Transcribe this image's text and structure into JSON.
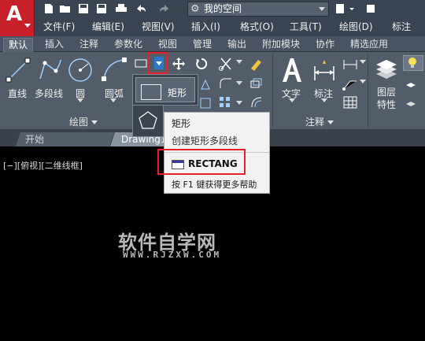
{
  "app": {
    "logo_letter": "A"
  },
  "workspace": {
    "value": "我的空间"
  },
  "menu": [
    {
      "label": "文件(F)"
    },
    {
      "label": "编辑(E)"
    },
    {
      "label": "视图(V)"
    },
    {
      "label": "插入(I)"
    },
    {
      "label": "格式(O)"
    },
    {
      "label": "工具(T)"
    },
    {
      "label": "绘图(D)"
    },
    {
      "label": "标注"
    }
  ],
  "ribbon_tabs": [
    {
      "label": "默认",
      "active": true
    },
    {
      "label": "插入"
    },
    {
      "label": "注释"
    },
    {
      "label": "参数化"
    },
    {
      "label": "视图"
    },
    {
      "label": "管理"
    },
    {
      "label": "输出"
    },
    {
      "label": "附加模块"
    },
    {
      "label": "协作"
    },
    {
      "label": "精选应用"
    }
  ],
  "draw_panel": {
    "title": "绘图",
    "tools": [
      {
        "label": "直线",
        "icon": "line-icon"
      },
      {
        "label": "多段线",
        "icon": "polyline-icon"
      },
      {
        "label": "圆",
        "icon": "circle-icon"
      },
      {
        "label": "圆弧",
        "icon": "arc-icon"
      }
    ]
  },
  "annotation_panel": {
    "title": "注释",
    "tools": [
      {
        "label": "文字",
        "icon": "text-icon"
      },
      {
        "label": "标注",
        "icon": "dimension-icon"
      }
    ]
  },
  "layer_panel": {
    "tool": {
      "label_line1": "图层",
      "label_line2": "特性",
      "icon": "layer-properties-icon"
    }
  },
  "rectangle_dropdown": {
    "rect_label": "矩形",
    "items": [
      "rectangle",
      "polygon"
    ]
  },
  "tooltip": {
    "title": "矩形",
    "description": "创建矩形多段线",
    "command": "RECTANG",
    "help": "按 F1 键获得更多帮助"
  },
  "document_tabs": [
    {
      "label": "开始"
    },
    {
      "label": "Drawing1",
      "active": true
    }
  ],
  "viewport_label": "[−][俯视][二维线框]",
  "watermark": {
    "title": "软件自学网",
    "url": "WWW.RJZXW.COM"
  },
  "colors": {
    "app_red": "#c8202a",
    "ribbon_bg": "#535c69",
    "highlight_red": "#e8202a",
    "canvas": "#000000",
    "tooltip_bg": "#f2f2f2"
  }
}
